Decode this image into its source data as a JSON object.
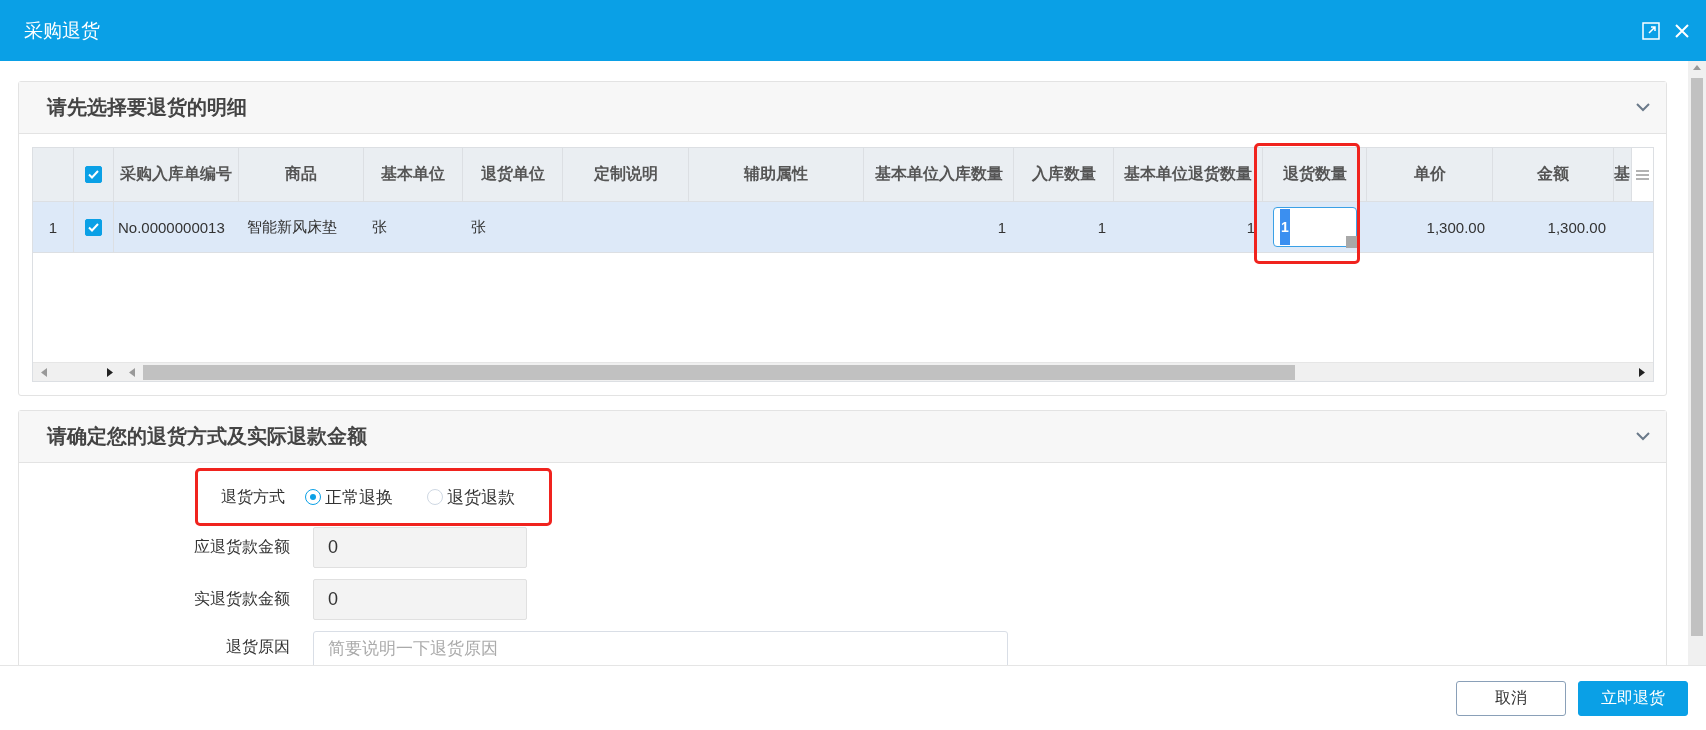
{
  "window": {
    "title": "采购退货"
  },
  "detail_panel": {
    "title": "请先选择要退货的明细",
    "expanded": true,
    "table": {
      "select_all_checked": true,
      "columns": [
        {
          "label": "采购入库单编号",
          "kind": "text",
          "highlighted": false
        },
        {
          "label": "商品",
          "kind": "text",
          "highlighted": false
        },
        {
          "label": "基本单位",
          "kind": "text",
          "highlighted": false
        },
        {
          "label": "退货单位",
          "kind": "text",
          "highlighted": false
        },
        {
          "label": "定制说明",
          "kind": "text",
          "highlighted": false
        },
        {
          "label": "辅助属性",
          "kind": "text",
          "highlighted": false
        },
        {
          "label": "基本单位入库数量",
          "kind": "number",
          "highlighted": false
        },
        {
          "label": "入库数量",
          "kind": "number",
          "highlighted": false
        },
        {
          "label": "基本单位退货数量",
          "kind": "number",
          "highlighted": false
        },
        {
          "label": "退货数量",
          "kind": "input",
          "highlighted": true
        },
        {
          "label": "单价",
          "kind": "number",
          "highlighted": false
        },
        {
          "label": "金额",
          "kind": "number",
          "highlighted": false
        },
        {
          "label": "基",
          "kind": "text",
          "highlighted": false
        }
      ],
      "rows": [
        {
          "row_number": "1",
          "checked": true,
          "selected": true,
          "cells": [
            "No.0000000013",
            "智能新风床垫",
            "张",
            "张",
            null,
            null,
            "1",
            "1",
            "1",
            "1",
            "1,300.00",
            "1,300.00",
            null
          ]
        }
      ]
    }
  },
  "return_panel": {
    "title": "请确定您的退货方式及实际退款金额",
    "expanded": true,
    "fields": [
      {
        "kind": "radio",
        "label": "退货方式",
        "highlighted": true,
        "options": [
          {
            "label": "正常退换",
            "selected": true
          },
          {
            "label": "退货退款",
            "selected": false
          }
        ]
      },
      {
        "kind": "readonly",
        "label": "应退货款金额",
        "value": "0"
      },
      {
        "kind": "readonly",
        "label": "实退货款金额",
        "value": "0"
      },
      {
        "kind": "textarea",
        "label": "退货原因",
        "placeholder": "简要说明一下退货原因"
      }
    ]
  },
  "buttons": [
    {
      "label": "取消",
      "kind": "secondary"
    },
    {
      "label": "立即退货",
      "kind": "primary"
    }
  ]
}
